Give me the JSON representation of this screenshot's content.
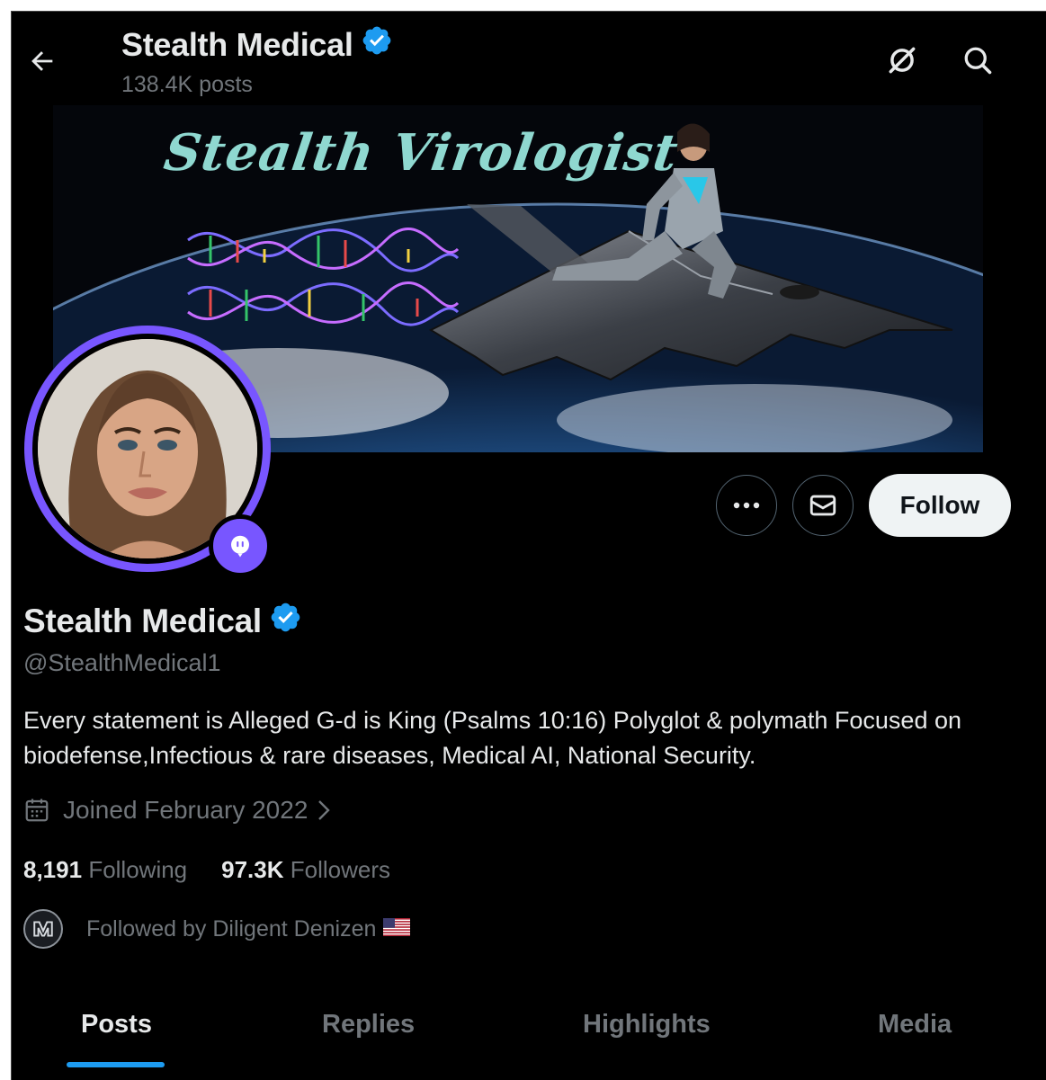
{
  "header": {
    "name": "Stealth Medical",
    "post_count": "138.4K posts"
  },
  "banner": {
    "title_text": "Stealth Virologist"
  },
  "actions": {
    "follow_label": "Follow"
  },
  "profile": {
    "name": "Stealth Medical",
    "handle": "@StealthMedical1",
    "bio": "Every statement is Alleged G-d is King (Psalms 10:16) Polyglot & polymath Focused on biodefense,Infectious & rare diseases, Medical AI, National Security.",
    "joined": "Joined February 2022",
    "following_count": "8,191",
    "following_label": "Following",
    "followers_count": "97.3K",
    "followers_label": "Followers",
    "followed_by": "Followed by Diligent Denizen"
  },
  "tabs": [
    {
      "label": "Posts",
      "active": true
    },
    {
      "label": "Replies",
      "active": false
    },
    {
      "label": "Highlights",
      "active": false
    },
    {
      "label": "Media",
      "active": false
    }
  ],
  "colors": {
    "background": "#000000",
    "text_primary": "#e7e9ea",
    "text_secondary": "#71767b",
    "verified_blue": "#1d9bf0",
    "spaces_purple": "#7856ff",
    "follow_button_bg": "#eff3f4"
  },
  "icons": {
    "back": "arrow-left-icon",
    "grok": "grok-icon",
    "search": "search-icon",
    "verified": "verified-badge-icon",
    "more": "more-dots-icon",
    "message": "envelope-icon",
    "calendar": "calendar-icon",
    "chevron": "chevron-right-icon",
    "spaces": "spaces-microphone-icon",
    "flag": "us-flag-icon"
  }
}
